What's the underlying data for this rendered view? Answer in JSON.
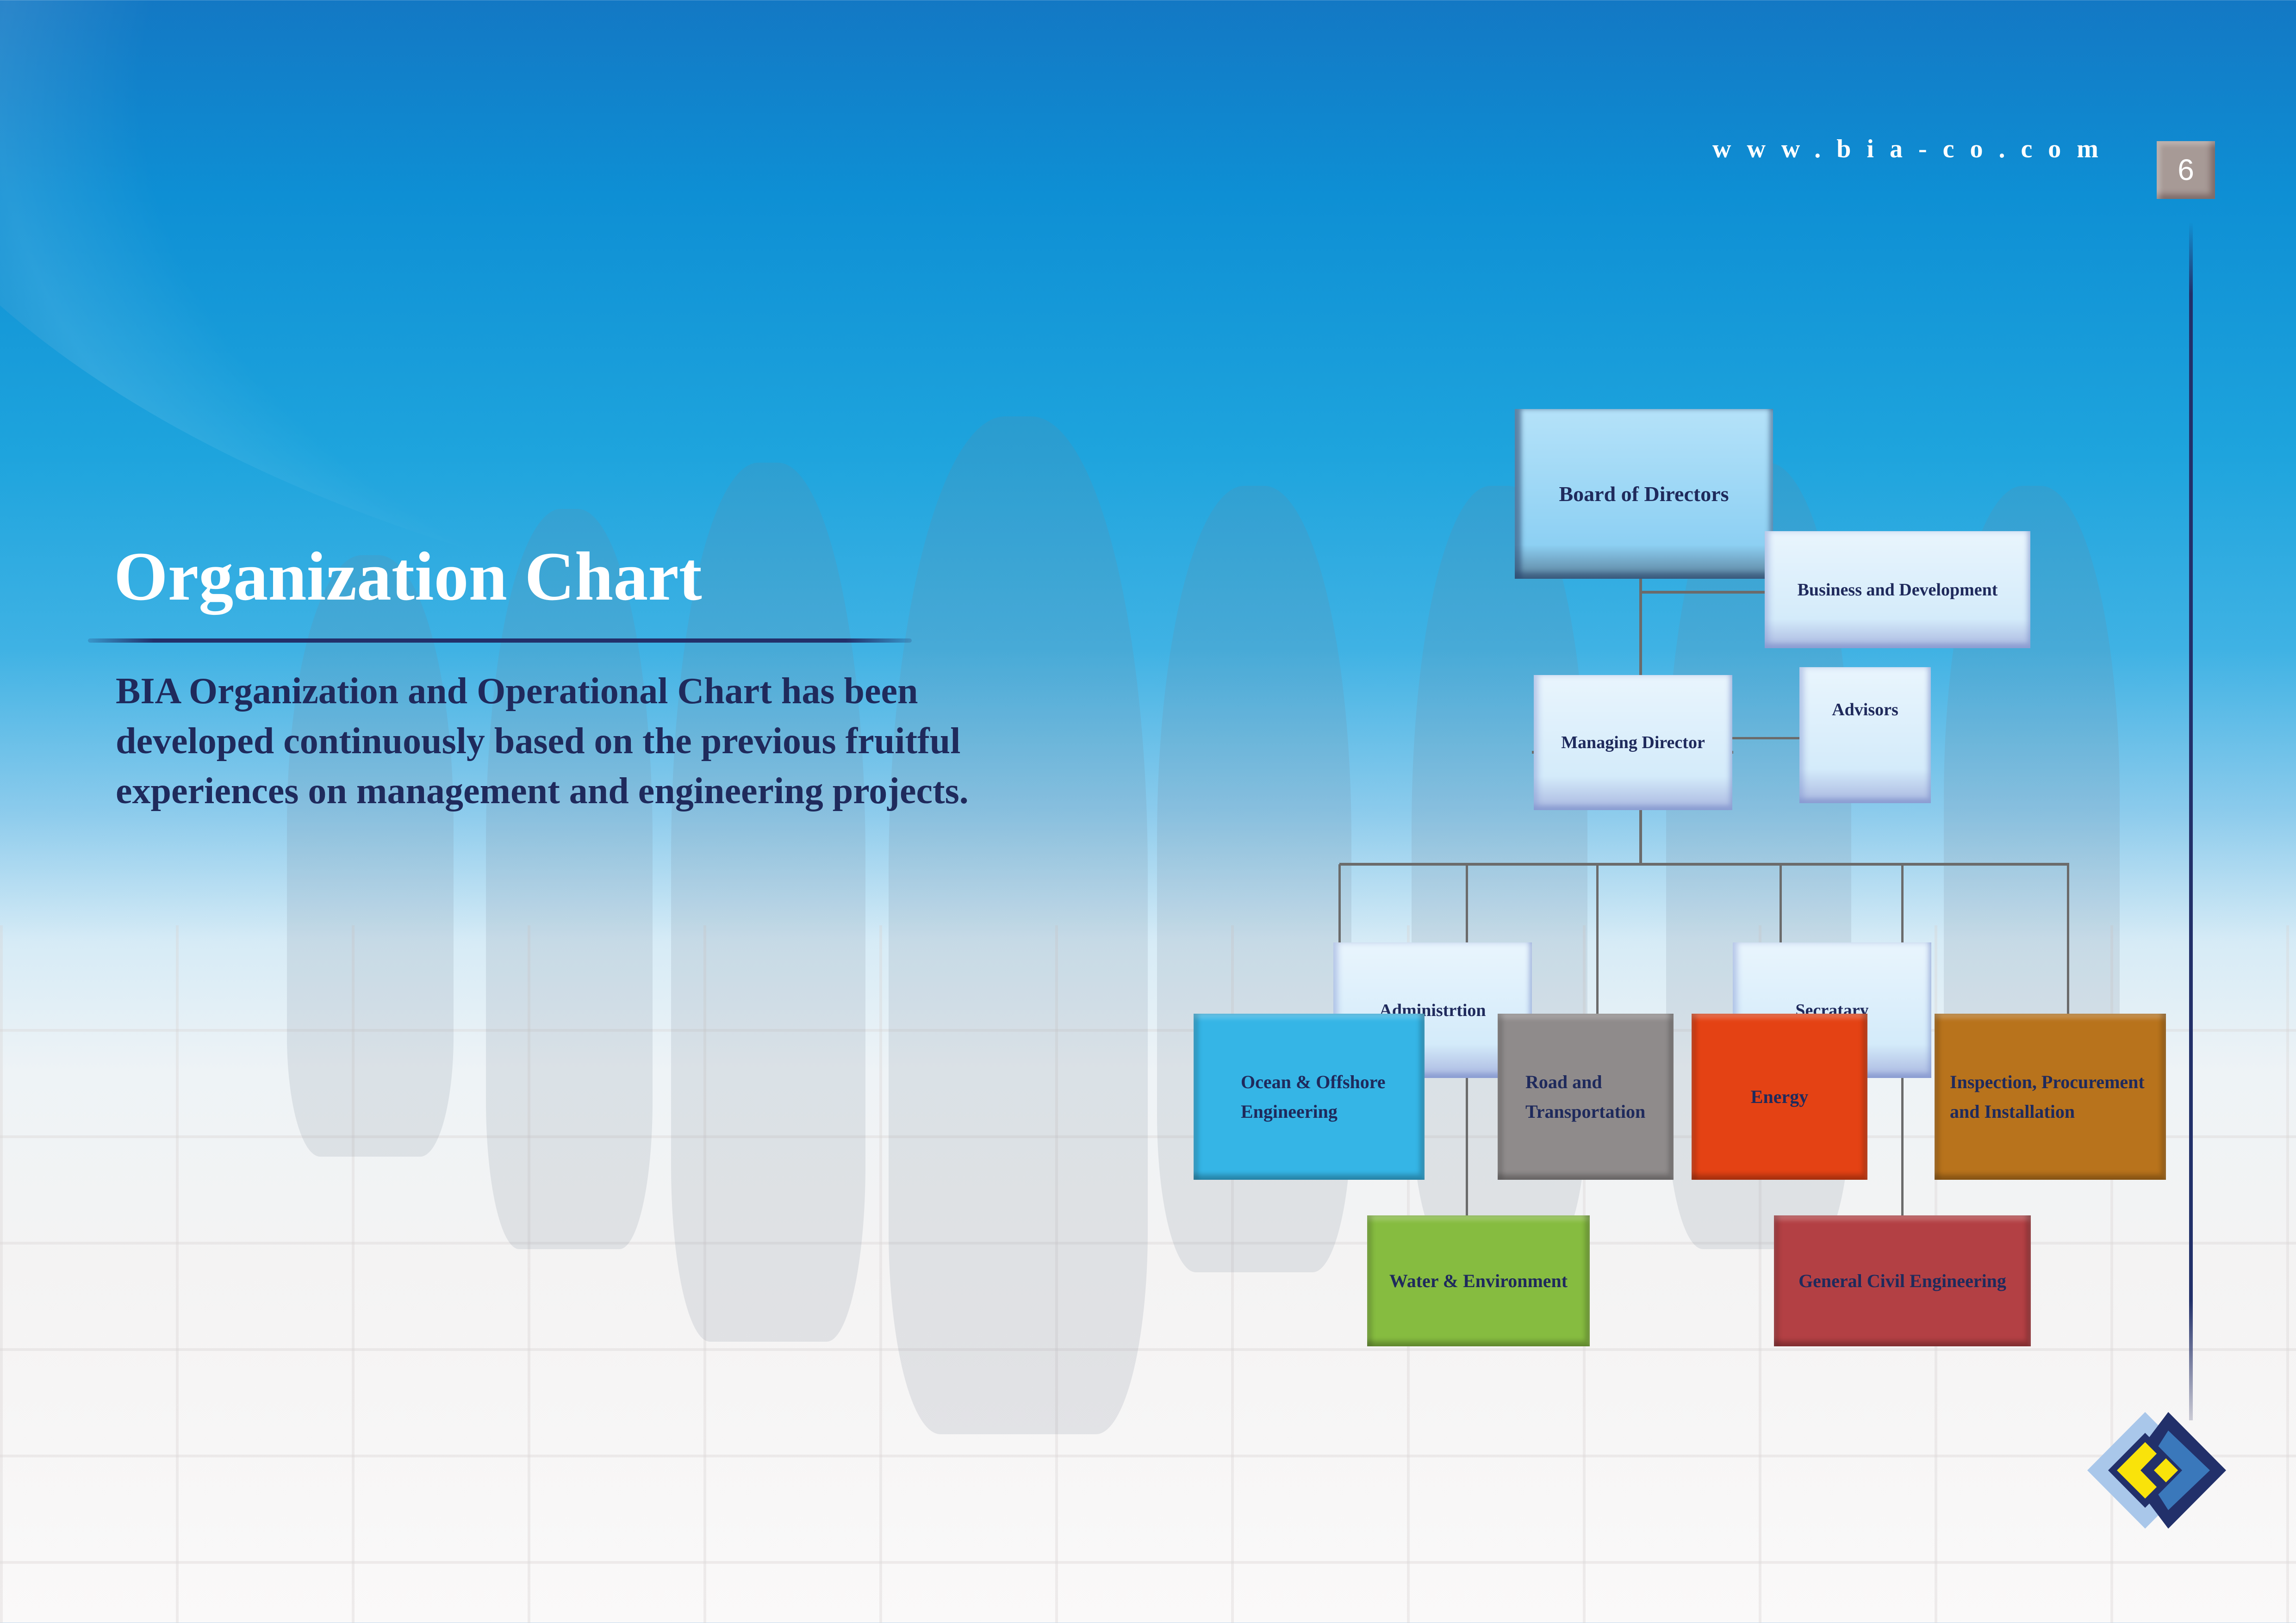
{
  "header": {
    "website": "www.bia-co.com",
    "page_number": "6"
  },
  "intro": {
    "title": "Organization Chart",
    "description_lines": [
      "BIA Organization and Operational  Chart  has been",
      "developed continuously based on the previous fruitful",
      "experiences on management and engineering  projects."
    ]
  },
  "org_chart": {
    "board": "Board of Directors",
    "business_development": "Business and Development",
    "managing_director": "Managing Director",
    "advisors": "Advisors",
    "administration": "Administrtion",
    "secretary": "Secratary",
    "departments": [
      {
        "lines": [
          "Ocean & Offshore",
          "Engineering"
        ],
        "color": "#35b5e6"
      },
      {
        "lines": [
          "Water & Environment"
        ],
        "color": "#86bc40"
      },
      {
        "lines": [
          "Road and",
          "Transportation"
        ],
        "color": "#8f8b8b"
      },
      {
        "lines": [
          "Energy"
        ],
        "color": "#e44214"
      },
      {
        "lines": [
          "General Civil Engineering"
        ],
        "color": "#b34044"
      },
      {
        "lines": [
          "Inspection, Procurement",
          "and Installation"
        ],
        "color": "#b8731c"
      }
    ]
  },
  "logo": {
    "icon": "bia-diamond-logo",
    "colors": [
      "#22306a",
      "#3a78bb",
      "#f9e30a"
    ]
  }
}
